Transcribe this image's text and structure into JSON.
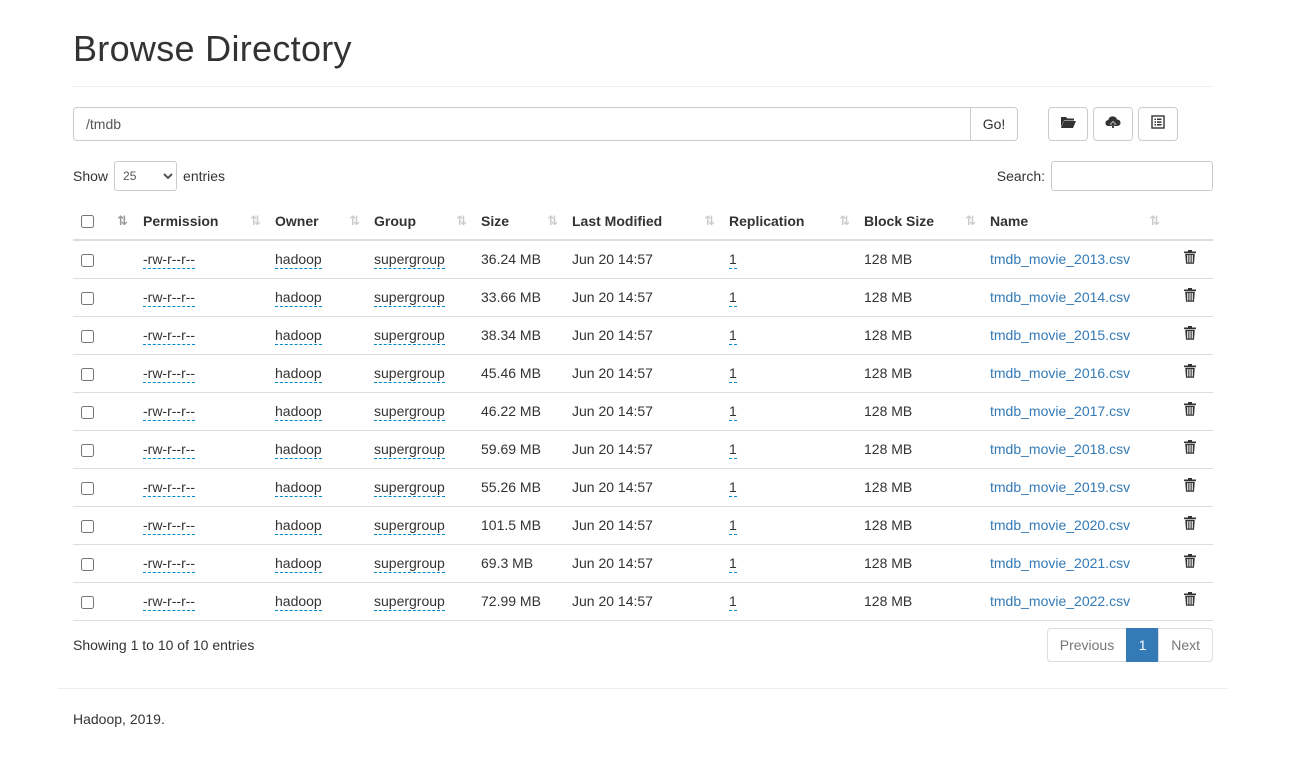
{
  "page": {
    "title": "Browse Directory",
    "footer": "Hadoop, 2019."
  },
  "pathbar": {
    "path": "/tmdb",
    "go_label": "Go!"
  },
  "toolbar": {
    "buttons": [
      {
        "icon": "folder-open-icon"
      },
      {
        "icon": "cloud-upload-icon"
      },
      {
        "icon": "list-alt-icon"
      }
    ]
  },
  "length": {
    "show_label": "Show",
    "value": "25",
    "entries_label": "entries"
  },
  "search": {
    "label": "Search:",
    "value": ""
  },
  "table": {
    "columns": [
      "Permission",
      "Owner",
      "Group",
      "Size",
      "Last Modified",
      "Replication",
      "Block Size",
      "Name"
    ],
    "rows": [
      {
        "permission": "-rw-r--r--",
        "owner": "hadoop",
        "group": "supergroup",
        "size": "36.24 MB",
        "modified": "Jun 20 14:57",
        "replication": "1",
        "block_size": "128 MB",
        "name": "tmdb_movie_2013.csv"
      },
      {
        "permission": "-rw-r--r--",
        "owner": "hadoop",
        "group": "supergroup",
        "size": "33.66 MB",
        "modified": "Jun 20 14:57",
        "replication": "1",
        "block_size": "128 MB",
        "name": "tmdb_movie_2014.csv"
      },
      {
        "permission": "-rw-r--r--",
        "owner": "hadoop",
        "group": "supergroup",
        "size": "38.34 MB",
        "modified": "Jun 20 14:57",
        "replication": "1",
        "block_size": "128 MB",
        "name": "tmdb_movie_2015.csv"
      },
      {
        "permission": "-rw-r--r--",
        "owner": "hadoop",
        "group": "supergroup",
        "size": "45.46 MB",
        "modified": "Jun 20 14:57",
        "replication": "1",
        "block_size": "128 MB",
        "name": "tmdb_movie_2016.csv"
      },
      {
        "permission": "-rw-r--r--",
        "owner": "hadoop",
        "group": "supergroup",
        "size": "46.22 MB",
        "modified": "Jun 20 14:57",
        "replication": "1",
        "block_size": "128 MB",
        "name": "tmdb_movie_2017.csv"
      },
      {
        "permission": "-rw-r--r--",
        "owner": "hadoop",
        "group": "supergroup",
        "size": "59.69 MB",
        "modified": "Jun 20 14:57",
        "replication": "1",
        "block_size": "128 MB",
        "name": "tmdb_movie_2018.csv"
      },
      {
        "permission": "-rw-r--r--",
        "owner": "hadoop",
        "group": "supergroup",
        "size": "55.26 MB",
        "modified": "Jun 20 14:57",
        "replication": "1",
        "block_size": "128 MB",
        "name": "tmdb_movie_2019.csv"
      },
      {
        "permission": "-rw-r--r--",
        "owner": "hadoop",
        "group": "supergroup",
        "size": "101.5 MB",
        "modified": "Jun 20 14:57",
        "replication": "1",
        "block_size": "128 MB",
        "name": "tmdb_movie_2020.csv"
      },
      {
        "permission": "-rw-r--r--",
        "owner": "hadoop",
        "group": "supergroup",
        "size": "69.3 MB",
        "modified": "Jun 20 14:57",
        "replication": "1",
        "block_size": "128 MB",
        "name": "tmdb_movie_2021.csv"
      },
      {
        "permission": "-rw-r--r--",
        "owner": "hadoop",
        "group": "supergroup",
        "size": "72.99 MB",
        "modified": "Jun 20 14:57",
        "replication": "1",
        "block_size": "128 MB",
        "name": "tmdb_movie_2022.csv"
      }
    ]
  },
  "pagination": {
    "info": "Showing 1 to 10 of 10 entries",
    "previous": "Previous",
    "current": "1",
    "next": "Next"
  },
  "colors": {
    "link": "#337ab7",
    "active_page": "#337ab7",
    "dashed_underline": "#0088cc"
  }
}
